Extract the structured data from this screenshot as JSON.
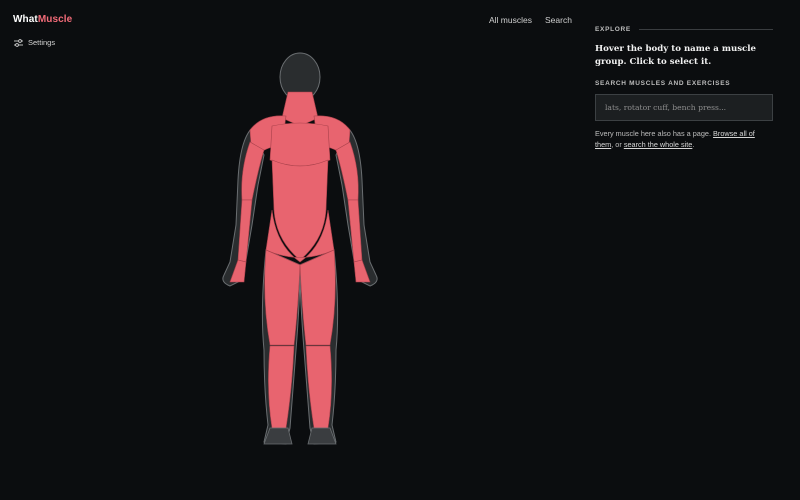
{
  "brand": {
    "name_part1": "What",
    "name_part2": "Muscle"
  },
  "settings": {
    "label": "Settings",
    "icon": "sliders-icon"
  },
  "nav": {
    "items": [
      {
        "label": "All muscles"
      },
      {
        "label": "Search"
      }
    ]
  },
  "explore": {
    "section_label": "EXPLORE",
    "headline": "Hover the body to name a muscle group. Click to select it."
  },
  "search": {
    "label": "SEARCH MUSCLES AND EXERCISES",
    "placeholder": "lats, rotator cuff, bench press...",
    "value": ""
  },
  "note": {
    "prefix": "Every muscle here also has a page. ",
    "link1": "Browse all of them",
    "middle": ", or ",
    "link2": "search the whole site",
    "suffix": "."
  },
  "colors": {
    "background": "#0b0d0f",
    "accent": "#f26b78",
    "muscle": "#e8646f",
    "skin_outline": "#5f6366"
  },
  "figure": {
    "view": "front",
    "icon": "human-body-model"
  }
}
